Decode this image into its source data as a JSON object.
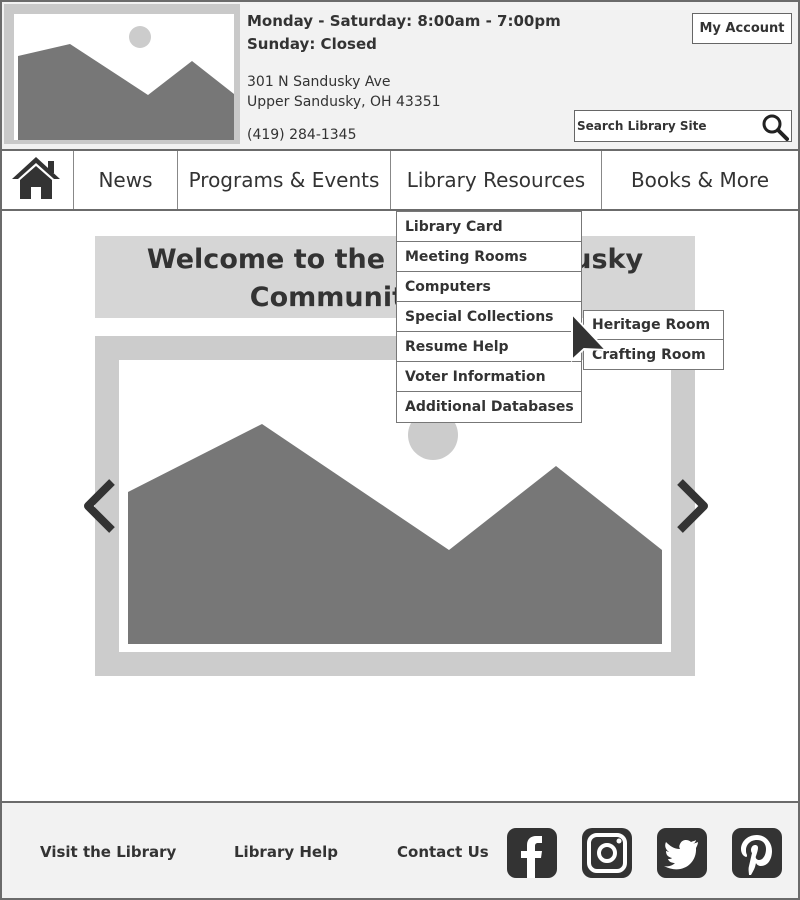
{
  "header": {
    "hours_weekday": "Monday - Saturday: 8:00am - 7:00pm",
    "hours_sunday": "Sunday: Closed",
    "address_line1": "301 N Sandusky Ave",
    "address_line2": "Upper Sandusky, OH 43351",
    "phone": "(419) 284-1345",
    "account_label": "My Account",
    "search_placeholder": "Search Library Site",
    "logo_icon": "image-placeholder-icon",
    "search_icon": "search-icon"
  },
  "nav": {
    "home_icon": "home-icon",
    "items": [
      {
        "label": "News"
      },
      {
        "label": "Programs & Events"
      },
      {
        "label": "Library Resources"
      },
      {
        "label": "Books & More"
      }
    ]
  },
  "dropdown": {
    "items": [
      {
        "label": "Library Card"
      },
      {
        "label": "Meeting Rooms"
      },
      {
        "label": "Computers"
      },
      {
        "label": "Special Collections"
      },
      {
        "label": "Resume Help"
      },
      {
        "label": "Voter Information"
      },
      {
        "label": "Additional Databases"
      }
    ],
    "submenu": [
      {
        "label": "Heritage Room"
      },
      {
        "label": "Crafting Room"
      }
    ]
  },
  "main": {
    "welcome_line1": "Welcome to the Upper Sandusky",
    "welcome_line2": "Community Library",
    "carousel_prev_icon": "chevron-left-icon",
    "carousel_next_icon": "chevron-right-icon"
  },
  "footer": {
    "links": [
      {
        "label": "Visit the Library"
      },
      {
        "label": "Library Help"
      },
      {
        "label": "Contact Us"
      }
    ],
    "social_icons": [
      "facebook-icon",
      "instagram-icon",
      "twitter-icon",
      "pinterest-icon"
    ]
  },
  "colors": {
    "wireframe_dark": "#333333",
    "panel_gray": "#d6d6d6",
    "mountain_gray": "#777777",
    "header_bg": "#f2f2f2"
  }
}
